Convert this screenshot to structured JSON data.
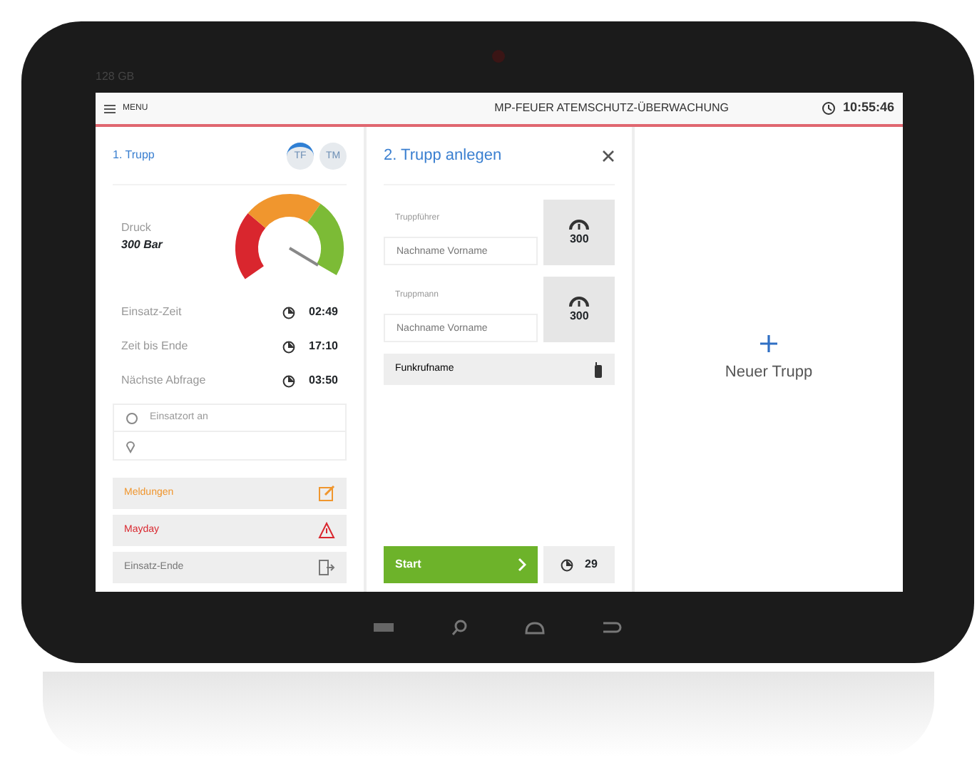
{
  "device": {
    "storage_label": "128 GB"
  },
  "header": {
    "menu_label": "MENU",
    "title": "MP-FEUER ATEMSCHUTZ-ÜBERWACHUNG",
    "time": "10:55:46"
  },
  "squad_panel": {
    "title": "1. Trupp",
    "members": [
      {
        "label": "TF",
        "selected": true
      },
      {
        "label": "TM",
        "selected": false
      }
    ],
    "pressure": {
      "label": "Druck",
      "value": "300 Bar"
    },
    "timers": [
      {
        "label": "Einsatz-Zeit",
        "value": "02:49"
      },
      {
        "label": "Zeit bis Ende",
        "value": "17:10"
      },
      {
        "label": "Nächste Abfrage",
        "value": "03:50"
      }
    ],
    "location": {
      "placeholder": "Einsatzort an"
    },
    "actions": [
      {
        "kind": "messages",
        "label": "Meldungen"
      },
      {
        "kind": "mayday",
        "label": "Mayday"
      },
      {
        "kind": "end",
        "label": "Einsatz-Ende"
      }
    ]
  },
  "create_panel": {
    "title": "2. Trupp anlegen",
    "fields": [
      {
        "label": "Truppführer",
        "placeholder": "Nachname Vorname",
        "pressure": "300"
      },
      {
        "label": "Truppmann",
        "placeholder": "Nachname Vorname",
        "pressure": "300"
      }
    ],
    "radio_name": {
      "label": "Funkrufname"
    },
    "start_label": "Start",
    "timer": "29"
  },
  "new_panel": {
    "label": "Neuer Trupp"
  }
}
